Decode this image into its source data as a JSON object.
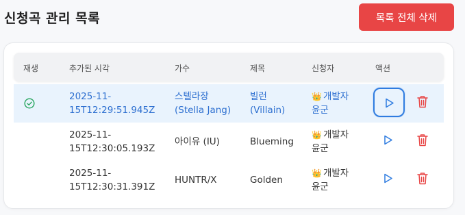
{
  "header": {
    "title": "신청곡 관리 목록",
    "delete_all_label": "목록 전체 삭제"
  },
  "table": {
    "columns": [
      "재생",
      "추가된 시각",
      "가수",
      "제목",
      "신청자",
      "액션"
    ],
    "rows": [
      {
        "time_line1": "2025-11-",
        "time_line2": "15T12:29:51.945Z",
        "artist_line1": "스텔라장",
        "artist_line2": "(Stella Jang)",
        "title_line1": "빌런",
        "title_line2": "(Villain)",
        "requester_line1": "개발자",
        "requester_line2": "윤군",
        "playing": true
      },
      {
        "time_line1": "2025-11-",
        "time_line2": "15T12:30:05.193Z",
        "artist_line1": "아이유 (IU)",
        "artist_line2": "",
        "title_line1": "Blueming",
        "title_line2": "",
        "requester_line1": "개발자",
        "requester_line2": "윤군",
        "playing": false
      },
      {
        "time_line1": "2025-11-",
        "time_line2": "15T12:30:31.391Z",
        "artist_line1": "HUNTR/X",
        "artist_line2": "",
        "title_line1": "Golden",
        "title_line2": "",
        "requester_line1": "개발자",
        "requester_line2": "윤군",
        "playing": false
      }
    ]
  },
  "icons": {
    "crown": "👑",
    "status": "check-circle-icon",
    "play": "play-icon",
    "delete": "trash-icon"
  },
  "colors": {
    "accent": "#2f7ce0",
    "danger": "#e84545",
    "success": "#22a35a",
    "playing_row": "#e9f3fd"
  }
}
